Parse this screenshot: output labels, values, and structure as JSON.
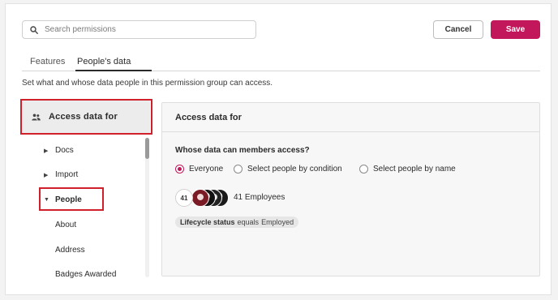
{
  "search": {
    "placeholder": "Search permissions",
    "icon": "search-icon"
  },
  "actions": {
    "cancel_label": "Cancel",
    "save_label": "Save",
    "save_color": "#c2185b"
  },
  "tabs": [
    {
      "label": "Features",
      "active": false
    },
    {
      "label": "People's data",
      "active": true
    }
  ],
  "description": "Set what and whose data people in this permission group can access.",
  "sidebar": {
    "header": {
      "label": "Access data for",
      "icon": "people-icon"
    },
    "items": [
      {
        "label": "Docs",
        "caret": "collapsed"
      },
      {
        "label": "Import",
        "caret": "collapsed"
      },
      {
        "label": "People",
        "caret": "expanded"
      },
      {
        "label": "About"
      },
      {
        "label": "Address"
      },
      {
        "label": "Badges Awarded"
      }
    ]
  },
  "panel": {
    "title": "Access data for",
    "question": "Whose data can members access?",
    "options": [
      {
        "label": "Everyone",
        "selected": true
      },
      {
        "label": "Select people by condition",
        "selected": false
      },
      {
        "label": "Select people by name",
        "selected": false
      }
    ],
    "avatar_count": "41",
    "employees_label": "41 Employees",
    "condition": {
      "field": "Lifecycle status",
      "operator": "equals",
      "value": "Employed"
    }
  },
  "colors": {
    "accent": "#c2185b",
    "highlight_box": "#d0202c"
  }
}
